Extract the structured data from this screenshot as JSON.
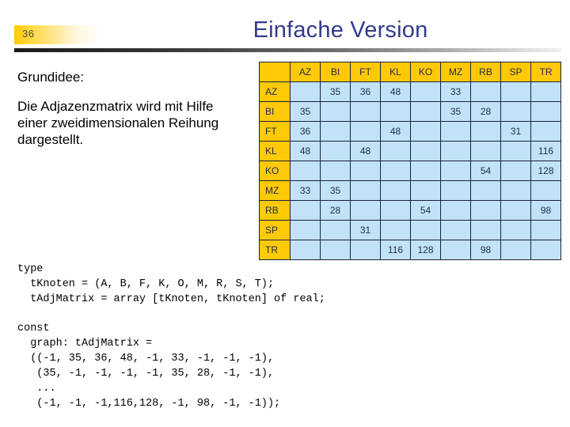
{
  "header": {
    "slide_number": "36",
    "title": "Einfache Version"
  },
  "content": {
    "intro_label": "Grundidee:",
    "intro_paragraph": "Die Adjazenzmatrix wird mit Hilfe einer zweidimensionalen Reihung dargestellt."
  },
  "matrix": {
    "corner": "",
    "columns": [
      "AZ",
      "BI",
      "FT",
      "KL",
      "KO",
      "MZ",
      "RB",
      "SP",
      "TR"
    ],
    "rows": [
      {
        "label": "AZ",
        "cells": [
          "",
          "35",
          "36",
          "48",
          "",
          "33",
          "",
          "",
          ""
        ]
      },
      {
        "label": "BI",
        "cells": [
          "35",
          "",
          "",
          "",
          "",
          "35",
          "28",
          "",
          ""
        ]
      },
      {
        "label": "FT",
        "cells": [
          "36",
          "",
          "",
          "48",
          "",
          "",
          "",
          "31",
          ""
        ]
      },
      {
        "label": "KL",
        "cells": [
          "48",
          "",
          "48",
          "",
          "",
          "",
          "",
          "",
          "116"
        ]
      },
      {
        "label": "KO",
        "cells": [
          "",
          "",
          "",
          "",
          "",
          "",
          "54",
          "",
          "128"
        ]
      },
      {
        "label": "MZ",
        "cells": [
          "33",
          "35",
          "",
          "",
          "",
          "",
          "",
          "",
          ""
        ]
      },
      {
        "label": "RB",
        "cells": [
          "",
          "28",
          "",
          "",
          "54",
          "",
          "",
          "",
          "98"
        ]
      },
      {
        "label": "SP",
        "cells": [
          "",
          "",
          "31",
          "",
          "",
          "",
          "",
          "",
          ""
        ]
      },
      {
        "label": "TR",
        "cells": [
          "",
          "",
          "",
          "116",
          "128",
          "",
          "98",
          "",
          ""
        ]
      }
    ]
  },
  "code": {
    "type_block": "type\n  tKnoten = (A, B, F, K, O, M, R, S, T);\n  tAdjMatrix = array [tKnoten, tKnoten] of real;",
    "const_block": "const\n  graph: tAdjMatrix =\n  ((-1, 35, 36, 48, -1, 33, -1, -1, -1),\n   (35, -1, -1, -1, -1, 35, 28, -1, -1),\n   ...\n   (-1, -1, -1,116,128, -1, 98, -1, -1));"
  },
  "colors": {
    "title": "#333a8e",
    "header_cell": "#FFC907",
    "data_cell": "#C2E3F7",
    "grid_line": "#1a2340"
  }
}
